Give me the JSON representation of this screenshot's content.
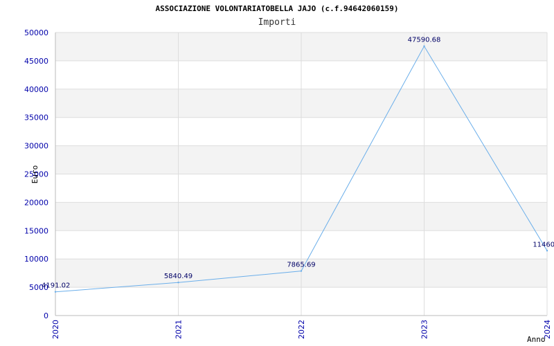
{
  "chart_data": {
    "type": "line",
    "title": "ASSOCIAZIONE VOLONTARIATOBELLA JAJO (c.f.94642060159)",
    "subtitle": "Importi",
    "xlabel": "Anno",
    "ylabel": "Euro",
    "x": [
      "2020",
      "2021",
      "2022",
      "2023",
      "2024"
    ],
    "series": [
      {
        "values": [
          4191.02,
          5840.49,
          7865.69,
          47590.68,
          11460.0
        ]
      }
    ],
    "data_labels": [
      "4191.02",
      "5840.49",
      "7865.69",
      "47590.68",
      "11460.0"
    ],
    "ylim": [
      0,
      50000
    ],
    "yticks": [
      "0",
      "5000",
      "10000",
      "15000",
      "20000",
      "25000",
      "30000",
      "35000",
      "40000",
      "45000",
      "50000"
    ],
    "grid": true,
    "line_color": "#6aaeea"
  }
}
